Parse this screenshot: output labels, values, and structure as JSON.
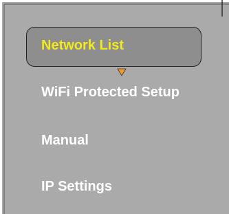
{
  "menu": {
    "items": [
      {
        "label": "Network List",
        "selected": true
      },
      {
        "label": "WiFi Protected Setup",
        "selected": false
      },
      {
        "label": "Manual",
        "selected": false
      },
      {
        "label": "IP Settings",
        "selected": false
      }
    ]
  },
  "colors": {
    "panel_background": "#aaaaaa",
    "highlight_fill": "#8e8e8e",
    "selected_text": "#f2ea1d",
    "normal_text": "#ffffff",
    "pointer": "#f39a2c"
  },
  "icons": {
    "selection_pointer": "triangle-down-icon"
  }
}
